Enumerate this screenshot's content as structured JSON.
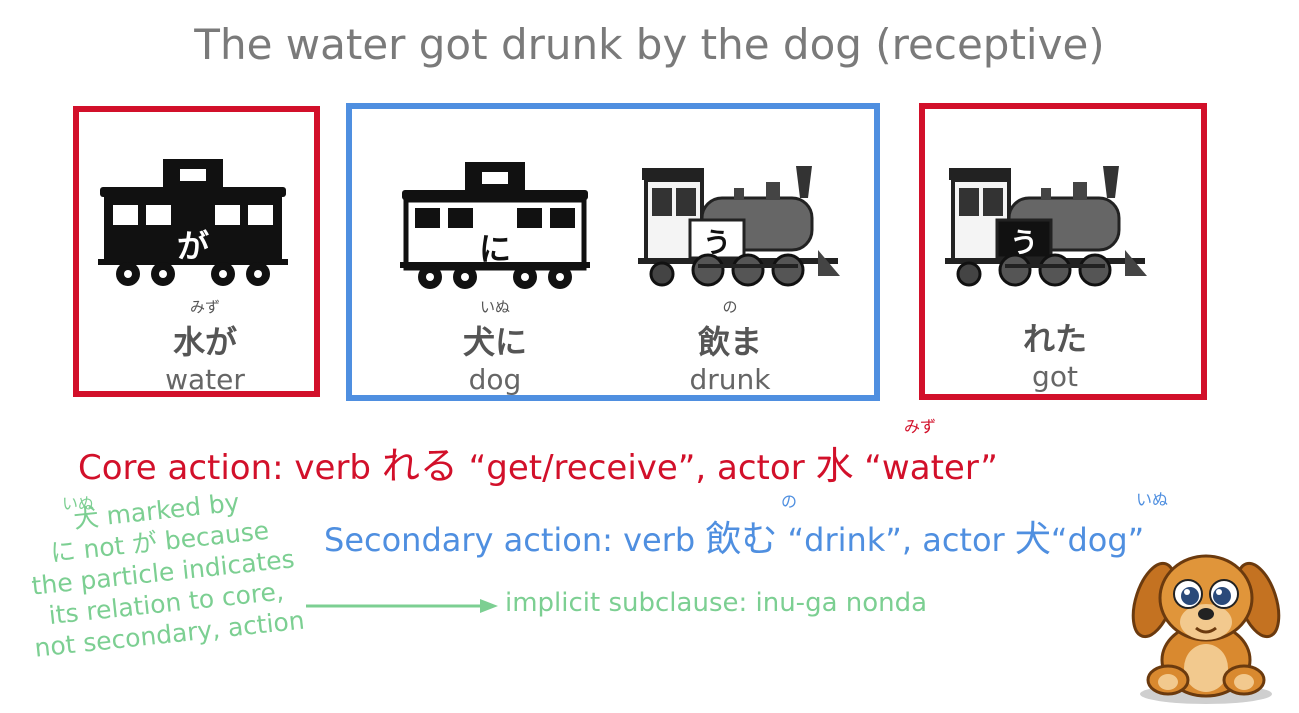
{
  "title": "The water got drunk by the dog (receptive)",
  "panels": {
    "water": {
      "wagon_char": "が",
      "ruby": "みず",
      "kana": "水が",
      "english": "water"
    },
    "dog": {
      "wagon_char": "に",
      "ruby": "いぬ",
      "kana": "犬に",
      "english": "dog"
    },
    "drunk": {
      "loco_char": "う",
      "ruby": "の",
      "kana": "飲ま",
      "english": "drunk"
    },
    "got": {
      "loco_char": "う",
      "kana": "れた",
      "english": "got"
    }
  },
  "core": {
    "prefix": "Core action: verb ",
    "verb": "れる",
    "gloss": " “get/receive”, actor ",
    "actor_ruby": "みず",
    "actor": "水",
    "actor_gloss": " “water”"
  },
  "secondary": {
    "prefix": "Secondary action: verb ",
    "verb_ruby": "の",
    "verb": "飲む",
    "gloss": " “drink”, actor ",
    "actor_ruby": "いぬ",
    "actor": "犬",
    "actor_gloss": "“dog”"
  },
  "note": {
    "ruby": "いぬ",
    "lines": [
      "犬 marked by",
      "に not が because",
      "the particle indicates",
      "its relation to core,",
      "not secondary, action"
    ]
  },
  "implicit": "implicit subclause: inu-ga nonda",
  "colors": {
    "red": "#d2102a",
    "blue": "#4f8fe0",
    "green": "#7ccf92",
    "gray": "#7a7a7a"
  }
}
